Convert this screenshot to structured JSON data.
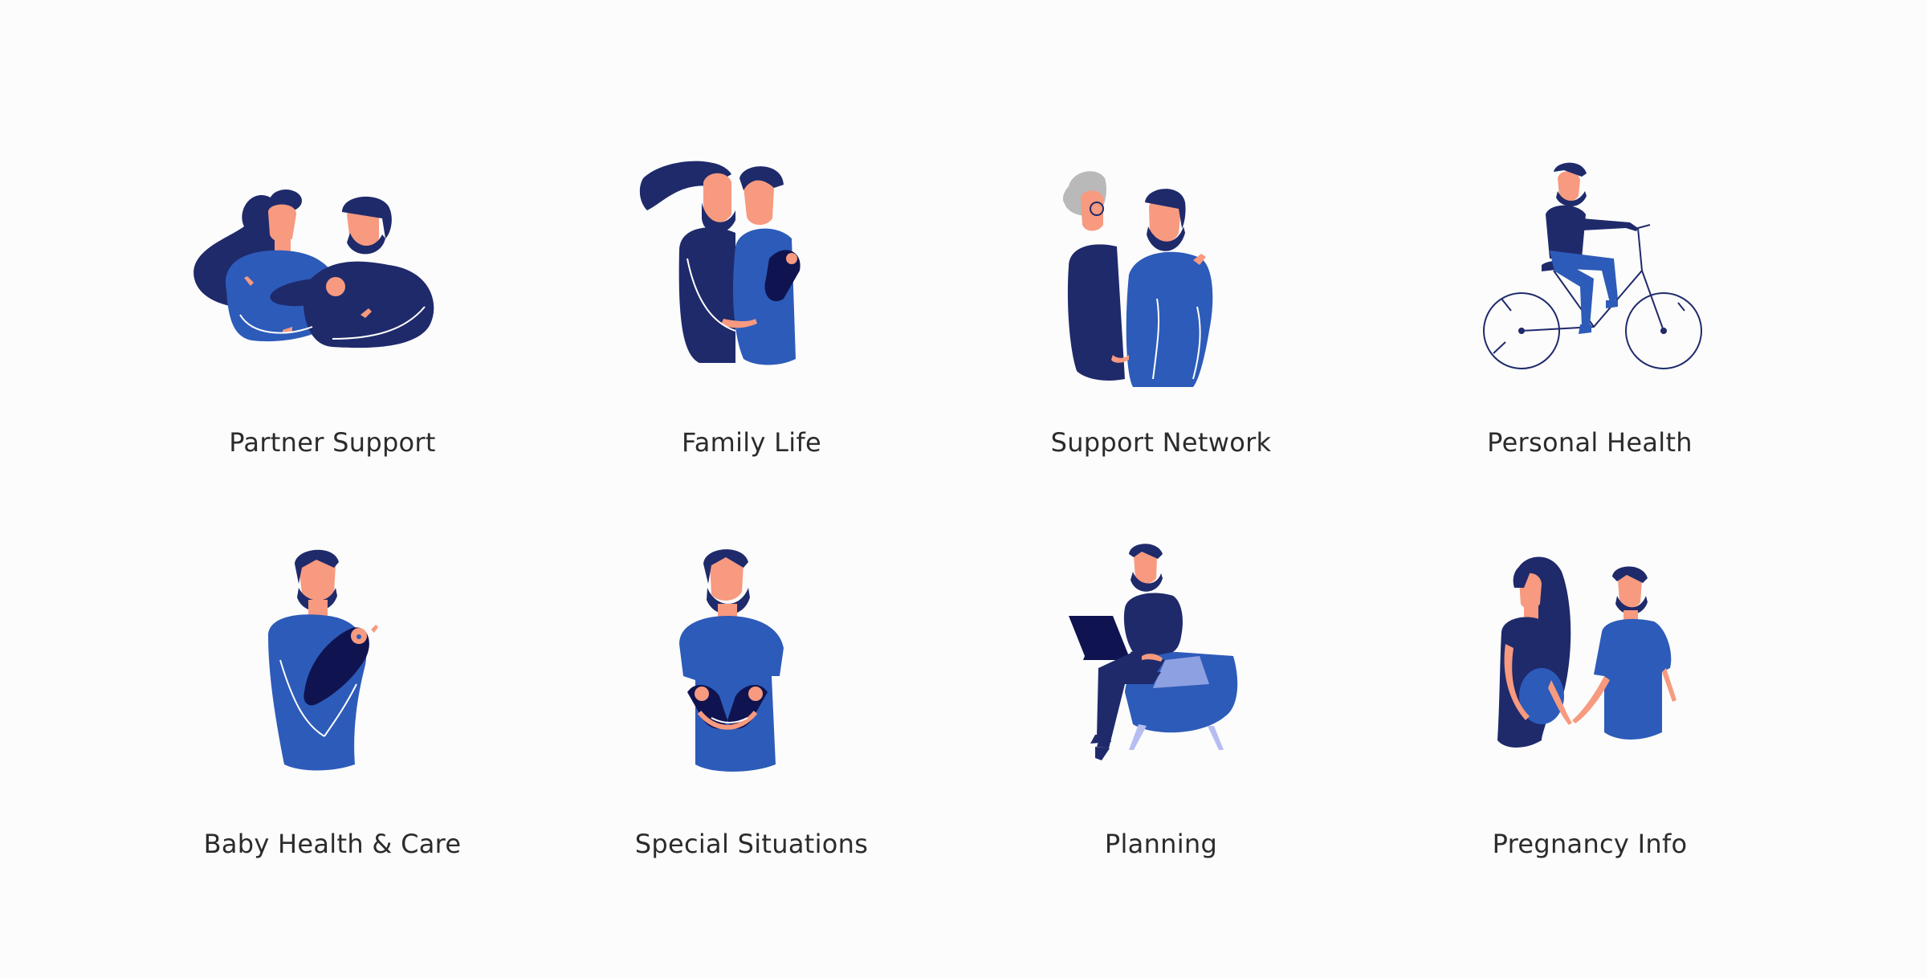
{
  "colors": {
    "navy": "#1f2a6b",
    "royal": "#2d5bb9",
    "skin": "#f79a7f",
    "dark": "#0f1450",
    "grey": "#b9b9b9",
    "lavender": "#b6bdf2"
  },
  "topics": [
    {
      "label": "Partner Support",
      "icon": "couple-with-baby-illustration"
    },
    {
      "label": "Family Life",
      "icon": "family-hug-illustration"
    },
    {
      "label": "Support Network",
      "icon": "grandmother-and-man-illustration"
    },
    {
      "label": "Personal Health",
      "icon": "man-cycling-illustration"
    },
    {
      "label": "Baby Health & Care",
      "icon": "father-holding-baby-illustration"
    },
    {
      "label": "Special Situations",
      "icon": "father-holding-twins-illustration"
    },
    {
      "label": "Planning",
      "icon": "man-with-laptop-illustration"
    },
    {
      "label": "Pregnancy Info",
      "icon": "pregnant-couple-illustration"
    }
  ]
}
